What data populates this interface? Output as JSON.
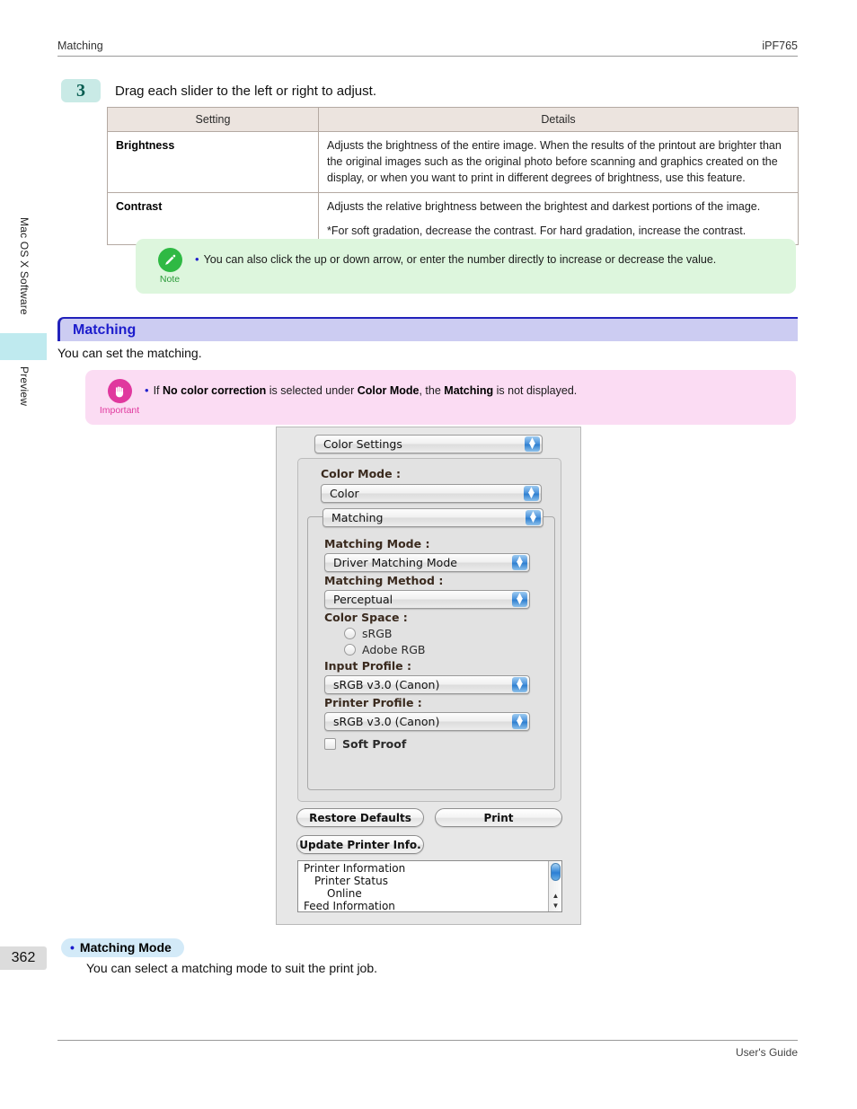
{
  "header": {
    "left": "Matching",
    "right": "iPF765"
  },
  "footer": {
    "right": "User's Guide"
  },
  "rail": {
    "software": "Mac OS X Software",
    "preview": "Preview",
    "page_number": "362"
  },
  "step": {
    "number": "3",
    "text": "Drag each slider to the left or right to adjust."
  },
  "table": {
    "headers": [
      "Setting",
      "Details"
    ],
    "rows": [
      {
        "setting": "Brightness",
        "details": [
          "Adjusts the brightness of the entire image. When the results of the printout are brighter than the original images such as the original photo before scanning and graphics created on the display, or when you want to print in different degrees of brightness, use this feature."
        ]
      },
      {
        "setting": "Contrast",
        "details": [
          "Adjusts the relative brightness between the brightest and darkest portions of the image.",
          "*For soft gradation, decrease the contrast. For hard gradation, increase the contrast."
        ]
      }
    ]
  },
  "note": {
    "label": "Note",
    "icon": "pencil-icon",
    "color": "#2fb944",
    "text": "You can also click the up or down arrow, or enter the number directly to increase or decrease the value."
  },
  "section": {
    "title": "Matching",
    "intro": "You can set the matching.",
    "accent": "#2222bb",
    "band": "#ccccf2"
  },
  "important": {
    "label": "Important",
    "icon": "hand-stop-icon",
    "color": "#e0389e",
    "text_parts": {
      "p1": "If ",
      "b1": "No color correction",
      "p2": " is selected under ",
      "b2": "Color Mode",
      "p3": ", the ",
      "b3": "Matching",
      "p4": " is not displayed."
    }
  },
  "dialog": {
    "pane_popup": "Color Settings",
    "color_mode_label": "Color Mode :",
    "color_mode_value": "Color",
    "matching_popup": "Matching",
    "fields": [
      {
        "label": "Matching Mode :",
        "value": "Driver Matching Mode"
      },
      {
        "label": "Matching Method :",
        "value": "Perceptual"
      }
    ],
    "color_space_label": "Color Space :",
    "color_space_options": [
      "sRGB",
      "Adobe RGB"
    ],
    "profiles": [
      {
        "label": "Input Profile :",
        "value": "sRGB v3.0 (Canon)"
      },
      {
        "label": "Printer Profile :",
        "value": "sRGB v3.0 (Canon)"
      }
    ],
    "soft_proof": "Soft Proof",
    "buttons": {
      "restore": "Restore Defaults",
      "print": "Print",
      "update": "Update Printer Info."
    },
    "info_list": [
      {
        "level": 0,
        "text": "Printer Information"
      },
      {
        "level": 1,
        "text": "Printer Status"
      },
      {
        "level": 2,
        "text": "Online"
      },
      {
        "level": 0,
        "text": "Feed Information"
      }
    ]
  },
  "bullet_section": {
    "heading": "Matching Mode",
    "body": "You can select a matching mode to suit the print job."
  }
}
